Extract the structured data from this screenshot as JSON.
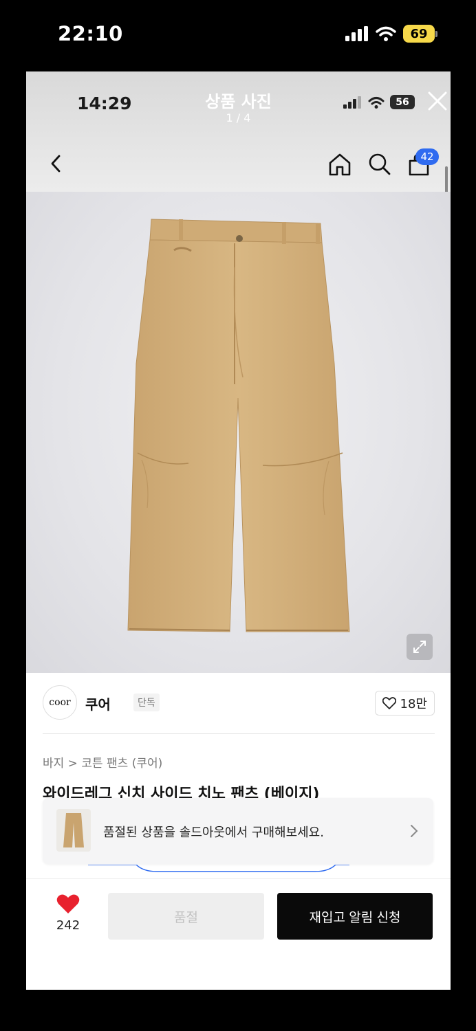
{
  "outer_status": {
    "time": "22:10",
    "battery": "69"
  },
  "inner_status": {
    "time": "14:29",
    "battery": "56"
  },
  "viewer": {
    "title": "상품 사진",
    "counter": "1 / 4"
  },
  "nav": {
    "cart_count": "42"
  },
  "brand": {
    "logo_text": "coor",
    "name": "쿠어",
    "tag": "단독",
    "likes": "18만"
  },
  "breadcrumb": "바지 > 코튼 팬츠 (쿠어)",
  "product": {
    "title": "와이드레그 신치 사이드 치노 팬츠 (베이지)"
  },
  "toast": {
    "text": "품절된 상품을 솔드아웃에서 구매해보세요."
  },
  "bottom_bar": {
    "wish_count": "242",
    "sold_out_label": "품절",
    "restock_label": "재입고 알림 신청"
  },
  "colors": {
    "product": "#d4b27f",
    "primary_button": "#0a0a0a",
    "badge": "#2f6bf0",
    "heart": "#e8212e"
  }
}
